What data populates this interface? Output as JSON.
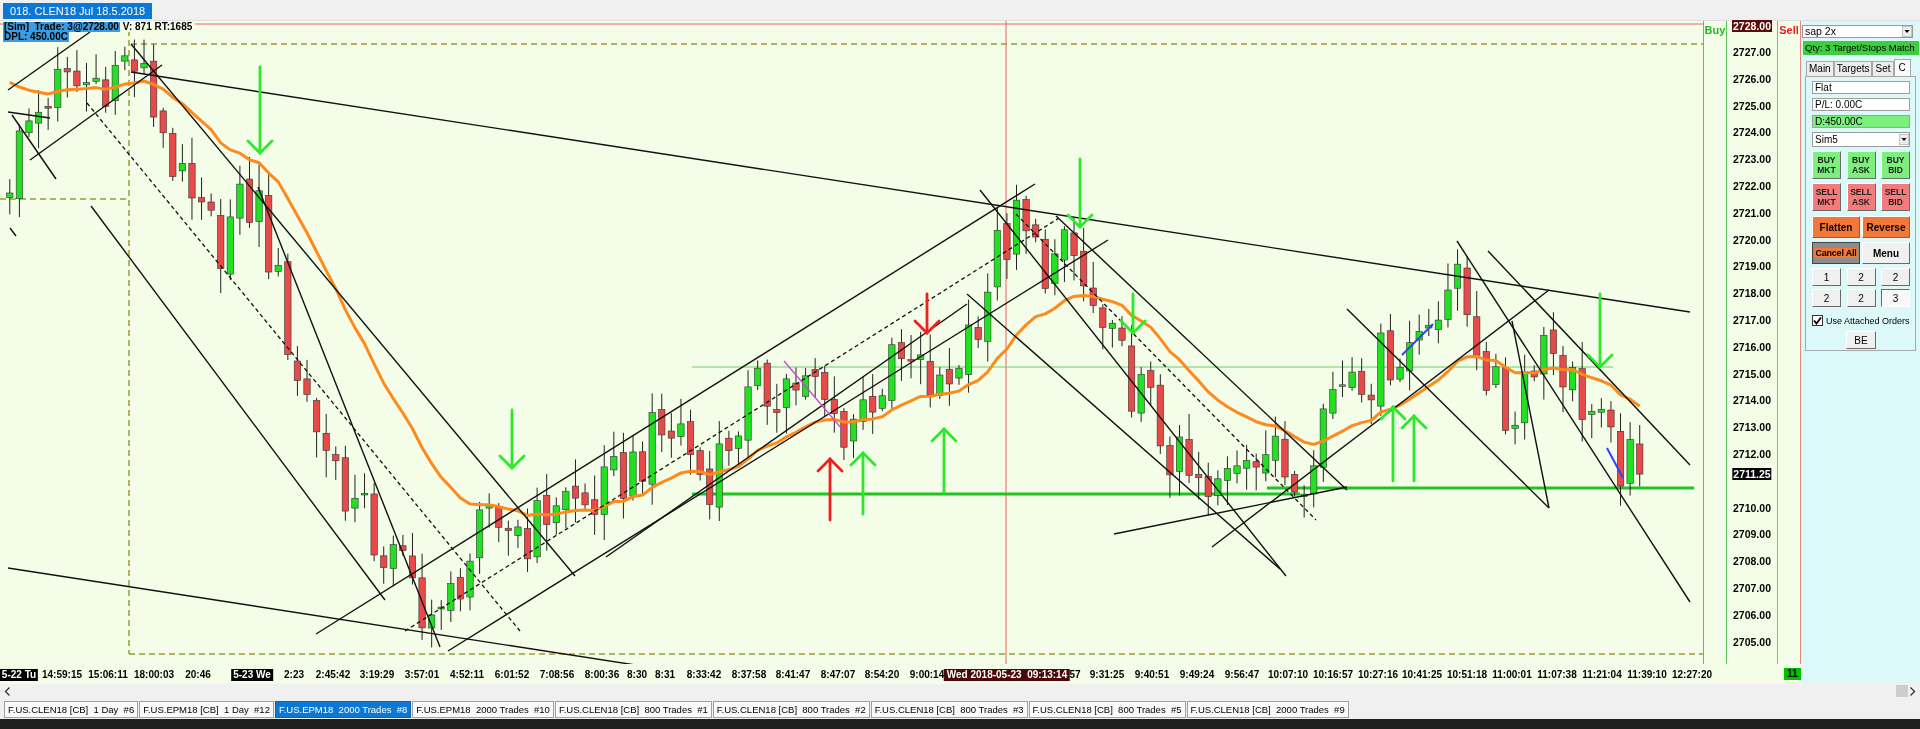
{
  "window": {
    "tab": "018. CLEN18 Jul 18.5.2018"
  },
  "chart": {
    "trade_info": "[Sim]  Trade: 3@2728.00",
    "volume_info": "V: 871 RT:1685",
    "daily_pl": "DPL: 450.00C",
    "buy_label": "Buy",
    "sell_label": "Sell",
    "price_axis": {
      "cursor_price": "2728.00",
      "ticks_upper": [
        "2727.00",
        "2726.00",
        "2725.00",
        "2724.00",
        "2723.00",
        "2722.00",
        "2721.00",
        "2720.00",
        "2719.00",
        "2718.00",
        "2717.00",
        "2716.00",
        "2715.00",
        "2714.00",
        "2713.00",
        "2712.00"
      ],
      "last_price": "2711.25",
      "ticks_lower": [
        "2710.00",
        "2709.00",
        "2708.00",
        "2707.00",
        "2706.00",
        "2705.00"
      ]
    },
    "time_axis": [
      {
        "kind": "date",
        "text": "5-22 Tu"
      },
      {
        "kind": "time",
        "text": "14:59:15"
      },
      {
        "kind": "time",
        "text": "15:06:11"
      },
      {
        "kind": "time",
        "text": "18:00:03"
      },
      {
        "kind": "time",
        "text": "20:46"
      },
      {
        "kind": "date",
        "text": "5-23 We"
      },
      {
        "kind": "time",
        "text": "2:23"
      },
      {
        "kind": "time",
        "text": "2:45:42"
      },
      {
        "kind": "time",
        "text": "3:19:29"
      },
      {
        "kind": "time",
        "text": "3:57:01"
      },
      {
        "kind": "time",
        "text": "4:52:11"
      },
      {
        "kind": "time",
        "text": "6:01:52"
      },
      {
        "kind": "time",
        "text": "7:08:56"
      },
      {
        "kind": "time",
        "text": "8:00:36"
      },
      {
        "kind": "time",
        "text": "8:30"
      },
      {
        "kind": "time",
        "text": "8:31"
      },
      {
        "kind": "time",
        "text": "8:33:42"
      },
      {
        "kind": "time",
        "text": "8:37:58"
      },
      {
        "kind": "time",
        "text": "8:41:47"
      },
      {
        "kind": "time",
        "text": "8:47:07"
      },
      {
        "kind": "time",
        "text": "8:54:20"
      },
      {
        "kind": "time",
        "text": "9:00:14"
      },
      {
        "kind": "cursor",
        "text": "Wed 2018-05-23  09:13:14"
      },
      {
        "kind": "time",
        "text": "57"
      },
      {
        "kind": "time",
        "text": "9:31:25"
      },
      {
        "kind": "time",
        "text": "9:40:51"
      },
      {
        "kind": "time",
        "text": "9:49:24"
      },
      {
        "kind": "time",
        "text": "9:56:47"
      },
      {
        "kind": "time",
        "text": "10:07:10"
      },
      {
        "kind": "time",
        "text": "10:16:57"
      },
      {
        "kind": "time",
        "text": "10:27:16"
      },
      {
        "kind": "time",
        "text": "10:41:25"
      },
      {
        "kind": "time",
        "text": "10:51:18"
      },
      {
        "kind": "time",
        "text": "11:00:01"
      },
      {
        "kind": "time",
        "text": "11:07:38"
      },
      {
        "kind": "time",
        "text": "11:21:04"
      },
      {
        "kind": "time",
        "text": "11:39:10"
      },
      {
        "kind": "time",
        "text": "12:27:20"
      }
    ],
    "bar_count": "11"
  },
  "order_panel": {
    "strategy": "sap 2x",
    "status": "Qty: 3 Target/Stops Match",
    "tabs": [
      {
        "label": "Main",
        "selected": false
      },
      {
        "label": "Targets",
        "selected": false
      },
      {
        "label": "Set",
        "selected": false
      },
      {
        "label": "C",
        "selected": true
      }
    ],
    "position": "Flat",
    "pnl": "P/L: 0.00C",
    "daily": "D:450.00C",
    "account": "Sim5",
    "order_buttons": [
      {
        "kind": "buy",
        "lines": [
          "BUY",
          "MKT"
        ]
      },
      {
        "kind": "buy",
        "lines": [
          "BUY",
          "ASK"
        ]
      },
      {
        "kind": "buy",
        "lines": [
          "BUY",
          "BID"
        ]
      },
      {
        "kind": "sell",
        "lines": [
          "SELL",
          "MKT"
        ]
      },
      {
        "kind": "sell",
        "lines": [
          "SELL",
          "ASK"
        ]
      },
      {
        "kind": "sell",
        "lines": [
          "SELL",
          "BID"
        ]
      }
    ],
    "actions": [
      {
        "kind": "flatten",
        "label": "Flatten"
      },
      {
        "kind": "reverse",
        "label": "Reverse"
      },
      {
        "kind": "cancel",
        "label": "Cancel All"
      },
      {
        "kind": "menu",
        "label": "Menu"
      }
    ],
    "quantities": [
      {
        "label": "1",
        "selected": false
      },
      {
        "label": "2",
        "selected": false
      },
      {
        "label": "2",
        "selected": false
      },
      {
        "label": "2",
        "selected": false
      },
      {
        "label": "2",
        "selected": false
      },
      {
        "label": "3",
        "selected": true
      }
    ],
    "attached_orders": {
      "label": "Use Attached Orders",
      "checked": true
    },
    "breakeven": "BE"
  },
  "chart_tabs": [
    {
      "label": "F.US.CLEN18 [CB]  1 Day  #6",
      "selected": false
    },
    {
      "label": "F.US.EPM18 [CB]  1 Day  #12",
      "selected": false
    },
    {
      "label": "F.US.EPM18  2000 Trades  #8",
      "selected": true
    },
    {
      "label": "F.US.EPM18  2000 Trades  #10",
      "selected": false
    },
    {
      "label": "F.US.CLEN18 [CB]  800 Trades  #1",
      "selected": false
    },
    {
      "label": "F.US.CLEN18 [CB]  800 Trades  #2",
      "selected": false
    },
    {
      "label": "F.US.CLEN18 [CB]  800 Trades  #3",
      "selected": false
    },
    {
      "label": "F.US.CLEN18 [CB]  800 Trades  #5",
      "selected": false
    },
    {
      "label": "F.US.CLEN18 [CB]  2000 Trades  #9",
      "selected": false
    }
  ]
}
